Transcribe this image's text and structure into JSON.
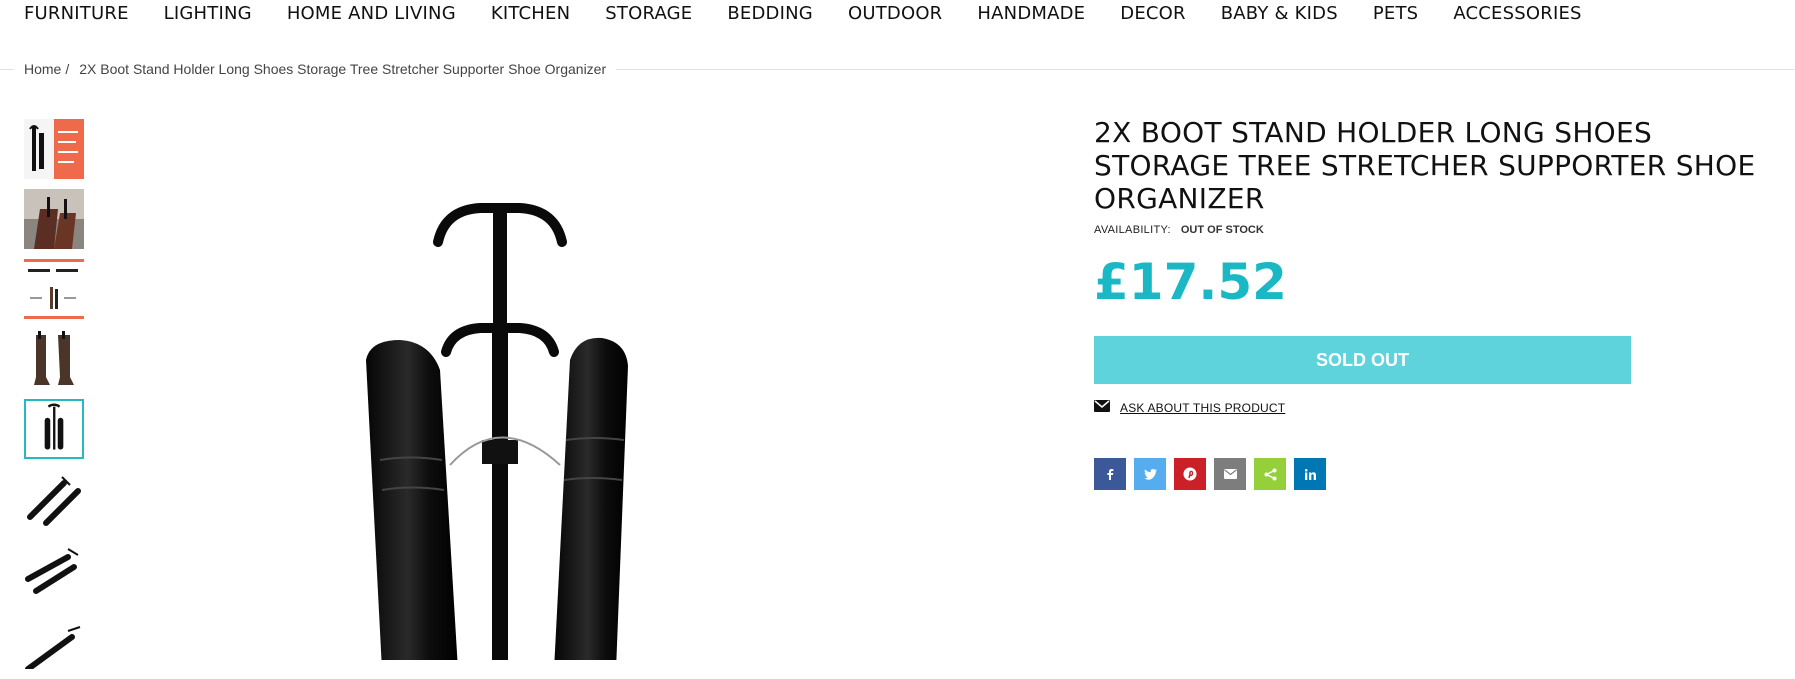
{
  "nav": {
    "items": [
      "FURNITURE",
      "LIGHTING",
      "HOME AND LIVING",
      "KITCHEN",
      "STORAGE",
      "BEDDING",
      "OUTDOOR",
      "HANDMADE",
      "DECOR",
      "BABY & KIDS",
      "PETS",
      "ACCESSORIES"
    ]
  },
  "breadcrumb": {
    "home": "Home",
    "separator": "/",
    "current": "2X Boot Stand Holder Long Shoes Storage Tree Stretcher Supporter Shoe Organizer"
  },
  "product": {
    "title": "2X BOOT STAND HOLDER LONG SHOES STORAGE TREE STRETCHER SUPPORTER SHOE ORGANIZER",
    "availability_label": "AVAILABILITY:",
    "availability_value": "OUT OF STOCK",
    "price": "£17.52",
    "button_label": "SOLD OUT",
    "ask_label": "ASK ABOUT THIS PRODUCT"
  },
  "share": [
    {
      "icon": "facebook-icon",
      "color": "#3b5998"
    },
    {
      "icon": "twitter-icon",
      "color": "#55acee"
    },
    {
      "icon": "pinterest-icon",
      "color": "#cb2027"
    },
    {
      "icon": "email-icon",
      "color": "#7d7d7d"
    },
    {
      "icon": "share-icon",
      "color": "#95d03a"
    },
    {
      "icon": "linkedin-icon",
      "color": "#0077b5"
    }
  ],
  "colors": {
    "accent": "#1ab8c4",
    "button": "#5fd3dc"
  }
}
